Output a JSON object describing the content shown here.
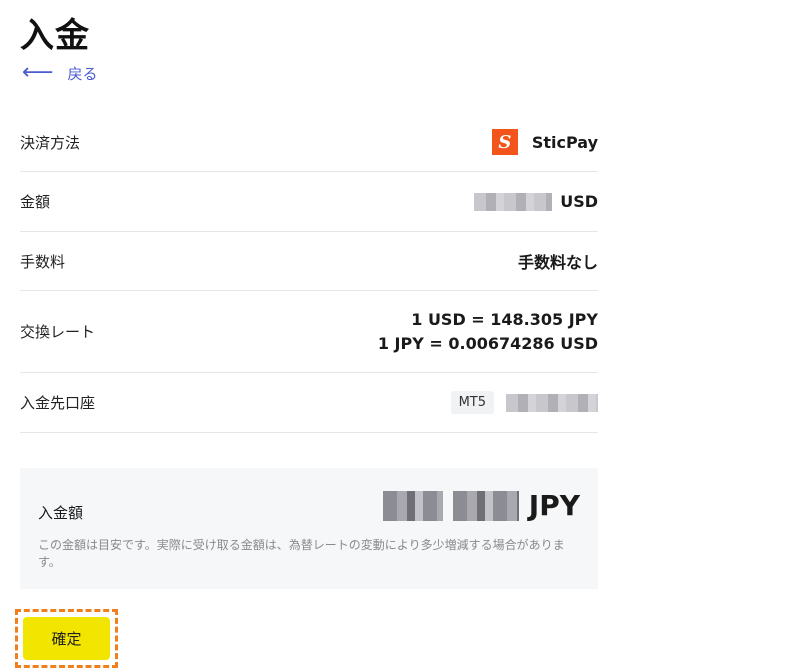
{
  "page": {
    "title": "入金",
    "back_label": "戻る"
  },
  "rows": {
    "payment_method": {
      "label": "決済方法",
      "value": "SticPay",
      "logo_letter": "S"
    },
    "amount": {
      "label": "金額",
      "currency": "USD"
    },
    "fee": {
      "label": "手数料",
      "value": "手数料なし"
    },
    "rate": {
      "label": "交換レート",
      "line1": "1 USD = 148.305 JPY",
      "line2": "1 JPY = 0.00674286 USD"
    },
    "account": {
      "label": "入金先口座",
      "badge": "MT5"
    }
  },
  "summary": {
    "label": "入金額",
    "currency": "JPY",
    "note": "この金額は目安です。実際に受け取る金額は、為替レートの変動により多少増減する場合があります。"
  },
  "actions": {
    "confirm_label": "確定"
  },
  "colors": {
    "accent_link": "#4a5bd0",
    "confirm_button": "#f2e600",
    "highlight_border": "#f07f1e",
    "sticpay_brand": "#f2541b"
  }
}
